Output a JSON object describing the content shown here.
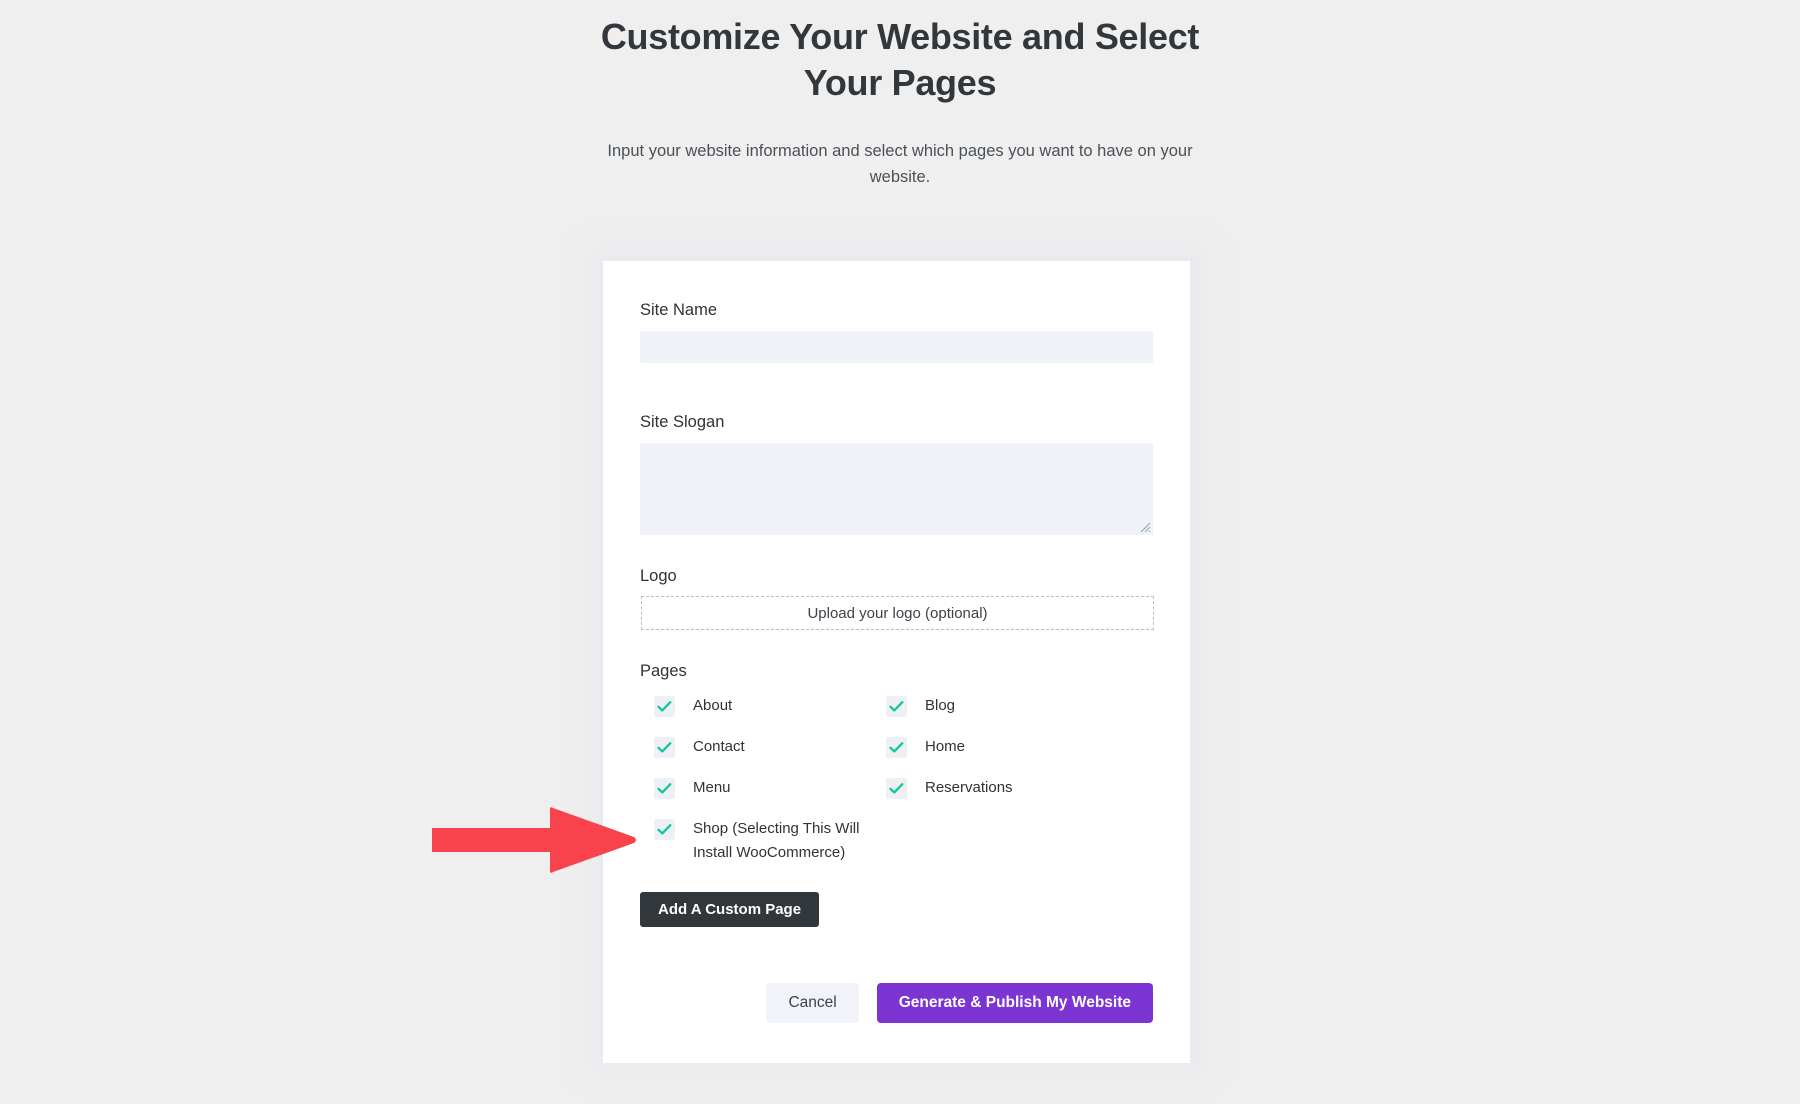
{
  "header": {
    "title": "Customize Your Website and Select Your Pages",
    "subtitle": "Input your website information and select which pages you want to have on your website."
  },
  "form": {
    "site_name": {
      "label": "Site Name",
      "value": "",
      "placeholder": ""
    },
    "site_slogan": {
      "label": "Site Slogan",
      "value": "",
      "placeholder": ""
    },
    "logo": {
      "label": "Logo",
      "dropzone_text": "Upload your logo (optional)"
    },
    "pages": {
      "label": "Pages",
      "options": [
        {
          "label": "About",
          "checked": true
        },
        {
          "label": "Blog",
          "checked": true
        },
        {
          "label": "Contact",
          "checked": true
        },
        {
          "label": "Home",
          "checked": true
        },
        {
          "label": "Menu",
          "checked": true
        },
        {
          "label": "Reservations",
          "checked": true
        },
        {
          "label": "Shop (Selecting This Will Install WooCommerce)",
          "checked": true
        }
      ]
    },
    "add_custom_page_label": "Add A Custom Page"
  },
  "actions": {
    "cancel_label": "Cancel",
    "publish_label": "Generate & Publish My Website"
  },
  "annotation": {
    "type": "arrow",
    "points_to": "Shop (Selecting This Will Install WooCommerce)",
    "color": "#f9434c"
  },
  "colors": {
    "page_background": "#efefef",
    "card_background": "#ffffff",
    "input_background": "#eff2f7",
    "checkbox_background": "#eef0f6",
    "checkmark": "#10c99a",
    "accent_purple": "#7c35d3",
    "dark_button": "#32373c",
    "annotation_red": "#f9434c",
    "title_text": "#32373c"
  }
}
